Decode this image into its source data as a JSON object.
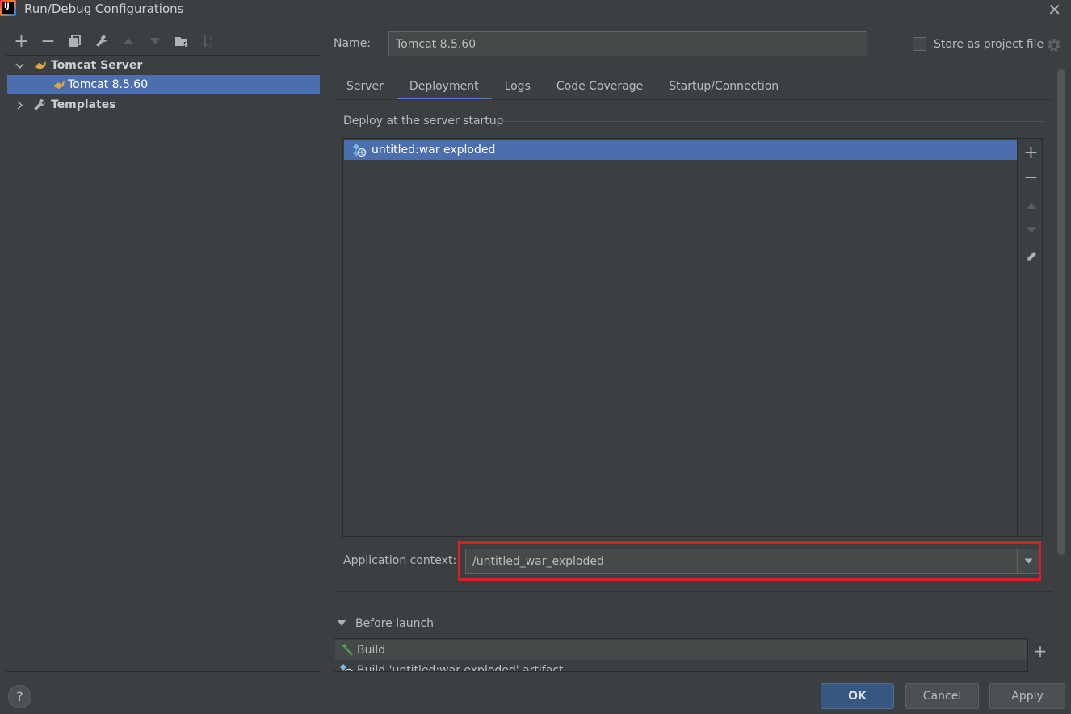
{
  "window": {
    "title": "Run/Debug Configurations",
    "close_glyph": "✕"
  },
  "toolbar": {
    "add": "+",
    "remove": "−"
  },
  "tree": {
    "group_label": "Tomcat Server",
    "selected_item": "Tomcat 8.5.60",
    "templates_label": "Templates"
  },
  "config": {
    "name_label": "Name:",
    "name_value": "Tomcat 8.5.60",
    "store_label": "Store as project file"
  },
  "tabs": [
    {
      "label": "Server"
    },
    {
      "label": "Deployment"
    },
    {
      "label": "Logs"
    },
    {
      "label": "Code Coverage"
    },
    {
      "label": "Startup/Connection"
    }
  ],
  "deployment": {
    "section_title": "Deploy at the server startup",
    "artifact": "untitled:war exploded",
    "add": "+",
    "remove": "−"
  },
  "app_context": {
    "label": "Application context:",
    "value": "/untitled_war_exploded"
  },
  "before_launch": {
    "title": "Before launch",
    "items": [
      {
        "label": "Build"
      },
      {
        "label": "Build 'untitled:war exploded' artifact"
      }
    ],
    "add": "+"
  },
  "footer": {
    "help": "?",
    "ok": "OK",
    "cancel": "Cancel",
    "apply": "Apply"
  },
  "colors": {
    "background": "#3c3f41",
    "selection": "#4b6eaf",
    "highlight_border": "#e11c24",
    "ok_button": "#365880"
  }
}
